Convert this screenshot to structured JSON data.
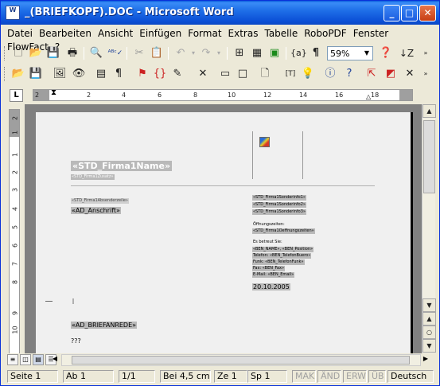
{
  "window": {
    "title": "_(BRIEFKOPF).DOC - Microsoft Word",
    "app_icon_text": "W"
  },
  "menu": [
    "Datei",
    "Bearbeiten",
    "Ansicht",
    "Einfügen",
    "Format",
    "Extras",
    "Tabelle",
    "RoboPDF",
    "Fenster",
    "FlowFact",
    "?"
  ],
  "toolbar1": {
    "zoom": "59%",
    "paragraph_mark": "¶",
    "field_code": "{a}"
  },
  "ruler": {
    "tab_selector": "L",
    "h_numbers": [
      "2",
      "2",
      "4",
      "6",
      "8",
      "10",
      "12",
      "14",
      "16",
      "18"
    ],
    "v_numbers": [
      "2",
      "1",
      "1",
      "2",
      "3",
      "4",
      "5",
      "6",
      "7",
      "8",
      "9",
      "10"
    ]
  },
  "document": {
    "firma_name": "«STD_Firma1Name»",
    "firma_zusatz": "«STD_Firma1Zusatz»",
    "absender_zeile": "«STD_Firma1Absenderzeile»",
    "anschrift": "«AD_Anschrift»",
    "sonder1": "«STD_Firma1Sonderinfo1»",
    "sonder2": "«STD_Firma1Sonderinfo2»",
    "sonder3": "«STD_Firma1Sonderinfo3»",
    "oeffnungszeiten_label": "Öffnungszeiten:",
    "oeffnungszeiten": "«STD_Firma1Oeffnungszeiten»",
    "bearbeiter_label": "Es betreut Sie:",
    "ben_name": "«BEN_NAME», «BEN_Position»",
    "telefon": "Telefon: «BEN_TelefonBuero»",
    "funk": "Funk: «BEN_TelefonFunk»",
    "fax": "Fax: «BEN_Fax»",
    "email": "E-Mail: «BEN_Email»",
    "datum": "20.10.2005",
    "briefanrede": "«AD_BRIEFANREDE»",
    "qqq": "???"
  },
  "statusbar": {
    "seite": "Seite 1",
    "ab": "Ab 1",
    "pages": "1/1",
    "bei": "Bei 4,5 cm",
    "ze": "Ze 1",
    "sp": "Sp 1",
    "mak": "MAK",
    "and": "ÄND",
    "erw": "ERW",
    "ub": "ÜB",
    "lang": "Deutsch"
  }
}
